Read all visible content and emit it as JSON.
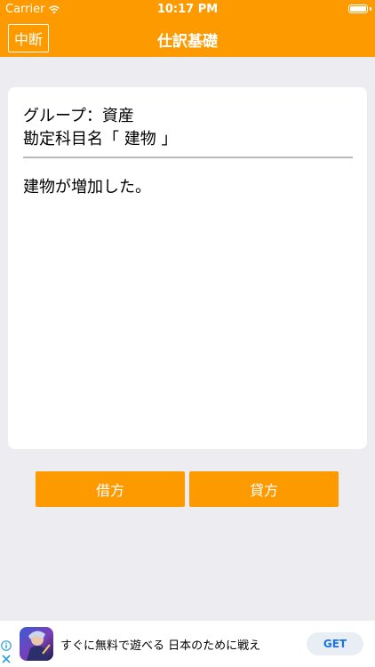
{
  "status_bar": {
    "carrier": "Carrier",
    "time": "10:17 PM"
  },
  "nav": {
    "interrupt_label": "中断",
    "title": "仕訳基礎"
  },
  "card": {
    "group_line": "グループ：資産",
    "account_line": "勘定科目名「 建物 」",
    "question": "建物が増加した。"
  },
  "buttons": {
    "debit_label": "借方",
    "credit_label": "貸方"
  },
  "ad": {
    "text": "すぐに無料で遊べる 日本のために戦え",
    "get_label": "GET"
  },
  "colors": {
    "accent": "#fd9a00",
    "background": "#ececf1",
    "card": "#ffffff",
    "get_button_text": "#1a73e8"
  },
  "icons": {
    "wifi": "wifi-icon",
    "battery": "battery-icon",
    "ad_info": "info-icon",
    "ad_close": "close-icon",
    "ad_app": "app-icon"
  }
}
